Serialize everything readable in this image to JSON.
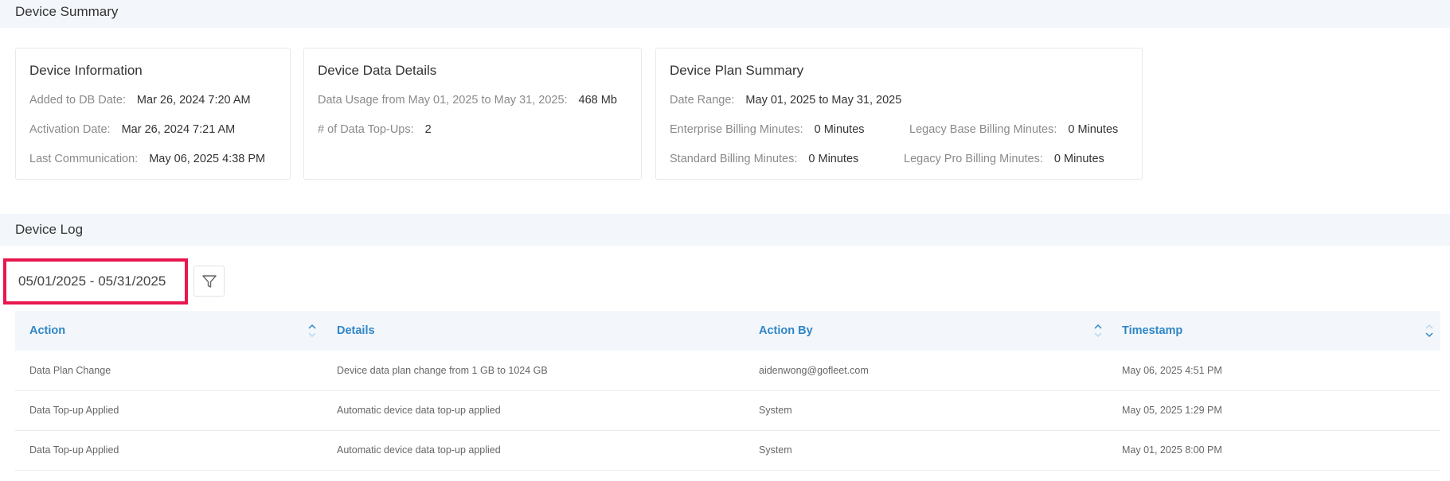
{
  "device_summary": {
    "title": "Device Summary",
    "device_information": {
      "title": "Device Information",
      "added_label": "Added to DB Date:",
      "added_value": "Mar 26, 2024 7:20 AM",
      "activation_label": "Activation Date:",
      "activation_value": "Mar 26, 2024 7:21 AM",
      "last_comm_label": "Last Communication:",
      "last_comm_value": "May 06, 2025 4:38 PM"
    },
    "device_data_details": {
      "title": "Device Data Details",
      "usage_label": "Data Usage from May 01, 2025 to May 31, 2025:",
      "usage_value": "468 Mb",
      "topups_label": "# of Data Top-Ups:",
      "topups_value": "2"
    },
    "device_plan_summary": {
      "title": "Device Plan Summary",
      "date_range_label": "Date Range:",
      "date_range_value": "May 01, 2025 to May 31, 2025",
      "enterprise_label": "Enterprise Billing Minutes:",
      "enterprise_value": "0 Minutes",
      "legacy_base_label": "Legacy Base Billing Minutes:",
      "legacy_base_value": "0 Minutes",
      "standard_label": "Standard Billing Minutes:",
      "standard_value": "0 Minutes",
      "legacy_pro_label": "Legacy Pro Billing Minutes:",
      "legacy_pro_value": "0 Minutes"
    }
  },
  "device_log": {
    "title": "Device Log",
    "date_range": "05/01/2025 - 05/31/2025",
    "columns": [
      "Action",
      "Details",
      "Action By",
      "Timestamp"
    ],
    "rows": [
      [
        "Data Plan Change",
        "Device data plan change from 1 GB to 1024 GB",
        "aidenwong@gofleet.com",
        "May 06, 2025 4:51 PM"
      ],
      [
        "Data Top-up Applied",
        "Automatic device data top-up applied",
        "System",
        "May 05, 2025 1:29 PM"
      ],
      [
        "Data Top-up Applied",
        "Automatic device data top-up applied",
        "System",
        "May 01, 2025 8:00 PM"
      ]
    ]
  },
  "colors": {
    "accent": "#2f86c7",
    "highlight_border": "#e8174f",
    "section_bg": "#f3f7fb"
  },
  "icons": {
    "filter": "filter-icon",
    "sort": "sort-icon"
  }
}
